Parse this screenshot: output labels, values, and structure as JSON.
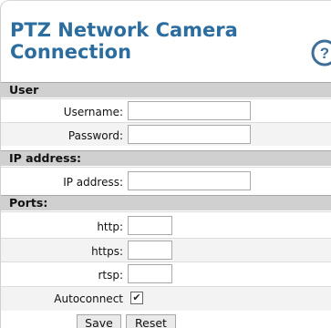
{
  "dialog": {
    "title": "PTZ Network Camera Connection",
    "help_icon": "help-question-icon"
  },
  "sections": {
    "user": "User",
    "ip": "IP address:",
    "ports": "Ports:"
  },
  "user": {
    "username_label": "Username:",
    "username_value": "",
    "password_label": "Password:",
    "password_value": ""
  },
  "ip": {
    "address_label": "IP address:",
    "address_value": ""
  },
  "ports": {
    "http_label": "http:",
    "http_value": "",
    "https_label": "https:",
    "https_value": "",
    "rtsp_label": "rtsp:",
    "rtsp_value": ""
  },
  "autoconnect": {
    "label": "Autoconnect",
    "checked": true,
    "check_glyph": "✔"
  },
  "buttons": {
    "save": "Save",
    "reset": "Reset"
  },
  "colors": {
    "title": "#2c6d9f",
    "section_bg": "#d0d0d0",
    "help_icon": "#3f6f98"
  }
}
